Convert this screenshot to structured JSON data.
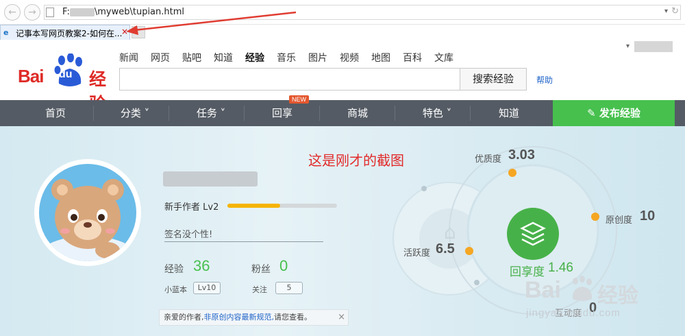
{
  "browser": {
    "address_prefix": "F:",
    "address_suffix": "\\myweb\\tupian.html",
    "tab_title": "记事本写网页教案2-如何在...",
    "tab_close": "×",
    "back": "←",
    "forward": "→",
    "dropdown": "▾",
    "refresh": "↻"
  },
  "header": {
    "logo_bai": "Bai",
    "logo_du": "du",
    "logo_jy": "经验",
    "nav": [
      "新闻",
      "网页",
      "贴吧",
      "知道",
      "经验",
      "音乐",
      "图片",
      "视频",
      "地图",
      "百科",
      "文库"
    ],
    "nav_active": "经验",
    "search_button": "搜索经验",
    "help": "帮助",
    "search_placeholder": ""
  },
  "category_bar": {
    "items": [
      "首页",
      "分类 ˅",
      "任务 ˅",
      "回享",
      "商城",
      "特色 ˅",
      "知道"
    ],
    "new_badge": "NEW",
    "publish": "发布经验"
  },
  "annotation": {
    "caption": "这是刚才的截图"
  },
  "profile": {
    "level_label": "新手作者 Lv2",
    "level_progress": 0.48,
    "signature": "签名没个性!",
    "exp_label": "经验",
    "exp_value": "36",
    "fans_label": "粉丝",
    "fans_value": "0",
    "xiaolanben_label": "小蓝本",
    "xiaolanben_value": "Lv10",
    "follow_label": "关注",
    "follow_value": "5",
    "notice_prefix": "亲爱的作者,",
    "notice_link": "非原创内容最新规范,",
    "notice_suffix": "请您查看。",
    "notice_close": "×"
  },
  "stats": {
    "quality_label": "优质度",
    "quality_value": "3.03",
    "original_label": "原创度",
    "original_value": "10",
    "activity_label": "活跃度",
    "activity_value": "6.5",
    "share_label": "回享度",
    "share_value": "1.46",
    "interaction_label": "互动度",
    "interaction_value": "0"
  },
  "watermark": {
    "brand_bai": "Bai",
    "brand_jy": "经验",
    "url": "jingyan.baidu.com"
  },
  "colors": {
    "brand_red": "#de2b27",
    "green": "#47c04e",
    "dark_bar": "#545b64",
    "level_orange": "#f5b400",
    "caption_red": "#e22a2a"
  }
}
